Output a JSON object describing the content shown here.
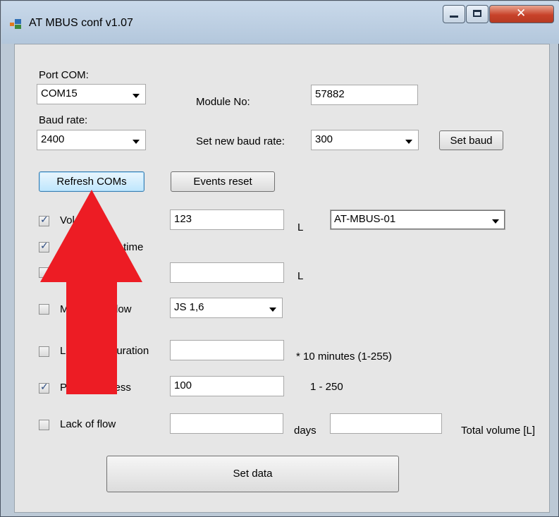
{
  "window": {
    "title": "AT MBUS conf v1.07",
    "minimize_icon": "minimize-icon",
    "maximize_icon": "maximize-icon",
    "close_icon": "close-icon"
  },
  "port": {
    "label": "Port COM:",
    "value": "COM15"
  },
  "module": {
    "label": "Module No:",
    "value": "57882"
  },
  "baud": {
    "label": "Baud rate:",
    "value": "2400"
  },
  "new_baud": {
    "label": "Set new baud rate:",
    "value": "300",
    "button": "Set baud"
  },
  "buttons": {
    "refresh": "Refresh COMs",
    "events_reset": "Events reset",
    "set_data": "Set data"
  },
  "rows": {
    "volume": {
      "label_visible": "Vol",
      "checked": true,
      "value": "123",
      "unit": "L",
      "model": "AT-MBUS-01"
    },
    "time": {
      "label_visible": "time",
      "checked": true
    },
    "flow": {
      "label_visible": "w",
      "checked": false,
      "value": "",
      "unit": "L"
    },
    "max_flow": {
      "label_visible_start": "M",
      "label_visible_end": "low",
      "checked": false,
      "value": "JS 1,6"
    },
    "duration": {
      "label_visible_start": "L",
      "label_visible_end": "duration",
      "checked": false,
      "value": "",
      "hint": "* 10 minutes (1-255)"
    },
    "primary": {
      "label": "Primary adress",
      "checked": true,
      "value": "100",
      "hint": "1 - 250"
    },
    "lack": {
      "label": "Lack of flow",
      "checked": false,
      "value": "",
      "unit": "days",
      "total_value": "",
      "total_label": "Total volume [L]"
    }
  },
  "annotation": {
    "arrow_color": "#ed1c24"
  },
  "colors": {
    "titlebar": "#c2d3e6",
    "client": "#e6e6e6",
    "close": "#c8422a"
  }
}
